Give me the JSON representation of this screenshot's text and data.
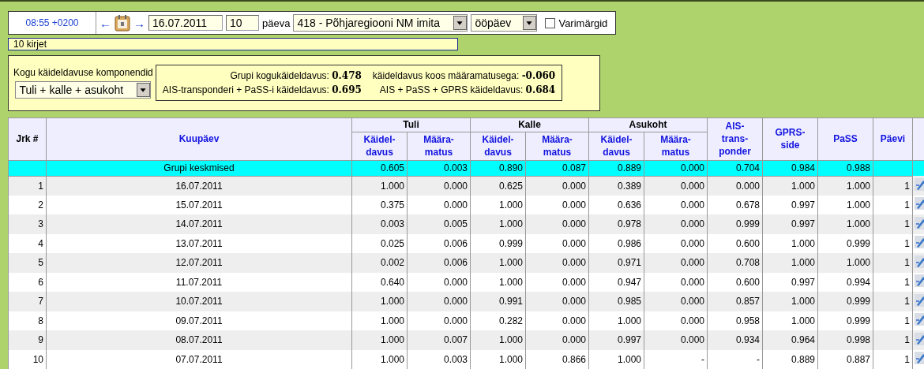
{
  "toolbar": {
    "time": "08:55 +0200",
    "prev": "←",
    "next": "→",
    "date": "16.07.2011",
    "days": "10",
    "days_unit": "päeva",
    "station": "418 - Põhjaregiooni NM imita",
    "period": "ööpäev",
    "shadow_checkbox": {
      "label": "Varimärgid",
      "checked": false
    }
  },
  "record_count": "10 kirjet",
  "components": {
    "label": "Kogu käideldavuse komponendid",
    "select": "Tuli + kalle + asukoht",
    "stats": [
      {
        "label": "Grupi kogukäideldavus:",
        "value": "0.478"
      },
      {
        "label": "käideldavus koos määramatusega:",
        "value": "-0.060"
      },
      {
        "label": "AIS-transponderi + PaSS-i käideldavus:",
        "value": "0.695"
      },
      {
        "label": "AIS + PaSS + GPRS käideldavus:",
        "value": "0.684"
      }
    ]
  },
  "table": {
    "jrk_header": "Jrk #",
    "date_header": "Kuupäev",
    "groups": [
      {
        "title": "Tuli",
        "columns": [
          "Käidel-\ndavus",
          "Määra-\nmatus"
        ]
      },
      {
        "title": "Kalle",
        "columns": [
          "Käidel-\ndavus",
          "Määra-\nmatus"
        ]
      },
      {
        "title": "Asukoht",
        "columns": [
          "Käidel-\ndavus",
          "Määra-\nmatus"
        ]
      }
    ],
    "extra_columns": [
      "AIS-\ntrans-\nponder",
      "GPRS-\nside",
      "PaSS",
      "Päevi"
    ],
    "rows": [
      {
        "kind": "average",
        "date": "Grupi keskmised",
        "values": [
          "0.605",
          "0.003",
          "0.890",
          "0.087",
          "0.889",
          "0.000",
          "0.704",
          "0.984",
          "0.988"
        ]
      },
      {
        "kind": "day",
        "number": "1",
        "date": "16.07.2011",
        "values": [
          "1.000",
          "0.000",
          "0.625",
          "0.000",
          "0.389",
          "0.000",
          "0.000",
          "1.000",
          "1.000"
        ],
        "days": "1"
      },
      {
        "kind": "day",
        "number": "2",
        "date": "15.07.2011",
        "values": [
          "0.375",
          "0.000",
          "1.000",
          "0.000",
          "0.636",
          "0.000",
          "0.678",
          "0.997",
          "1.000"
        ],
        "days": "1"
      },
      {
        "kind": "day",
        "number": "3",
        "date": "14.07.2011",
        "values": [
          "0.003",
          "0.005",
          "1.000",
          "0.000",
          "0.978",
          "0.000",
          "0.999",
          "0.997",
          "1.000"
        ],
        "days": "1"
      },
      {
        "kind": "day",
        "number": "4",
        "date": "13.07.2011",
        "values": [
          "0.025",
          "0.006",
          "0.999",
          "0.000",
          "0.986",
          "0.000",
          "0.600",
          "1.000",
          "0.999"
        ],
        "days": "1"
      },
      {
        "kind": "day",
        "number": "5",
        "date": "12.07.2011",
        "values": [
          "0.002",
          "0.006",
          "1.000",
          "0.000",
          "0.971",
          "0.000",
          "0.708",
          "1.000",
          "1.000"
        ],
        "days": "1"
      },
      {
        "kind": "day",
        "number": "6",
        "date": "11.07.2011",
        "values": [
          "0.640",
          "0.000",
          "1.000",
          "0.000",
          "0.947",
          "0.000",
          "0.600",
          "0.997",
          "0.994"
        ],
        "days": "1"
      },
      {
        "kind": "day",
        "number": "7",
        "date": "10.07.2011",
        "values": [
          "1.000",
          "0.000",
          "0.991",
          "0.000",
          "0.985",
          "0.000",
          "0.857",
          "1.000",
          "0.999"
        ],
        "days": "1"
      },
      {
        "kind": "day",
        "number": "8",
        "date": "09.07.2011",
        "values": [
          "1.000",
          "0.000",
          "0.282",
          "0.000",
          "1.000",
          "0.000",
          "0.958",
          "1.000",
          "0.999"
        ],
        "days": "1"
      },
      {
        "kind": "day",
        "number": "9",
        "date": "08.07.2011",
        "values": [
          "1.000",
          "0.007",
          "1.000",
          "0.000",
          "0.997",
          "0.000",
          "0.934",
          "0.964",
          "0.998"
        ],
        "days": "1"
      },
      {
        "kind": "day",
        "number": "10",
        "date": "07.07.2011",
        "values": [
          "1.000",
          "0.003",
          "1.000",
          "0.866",
          "1.000",
          "-",
          "-",
          "0.889",
          "0.887"
        ],
        "days": "1"
      }
    ]
  }
}
